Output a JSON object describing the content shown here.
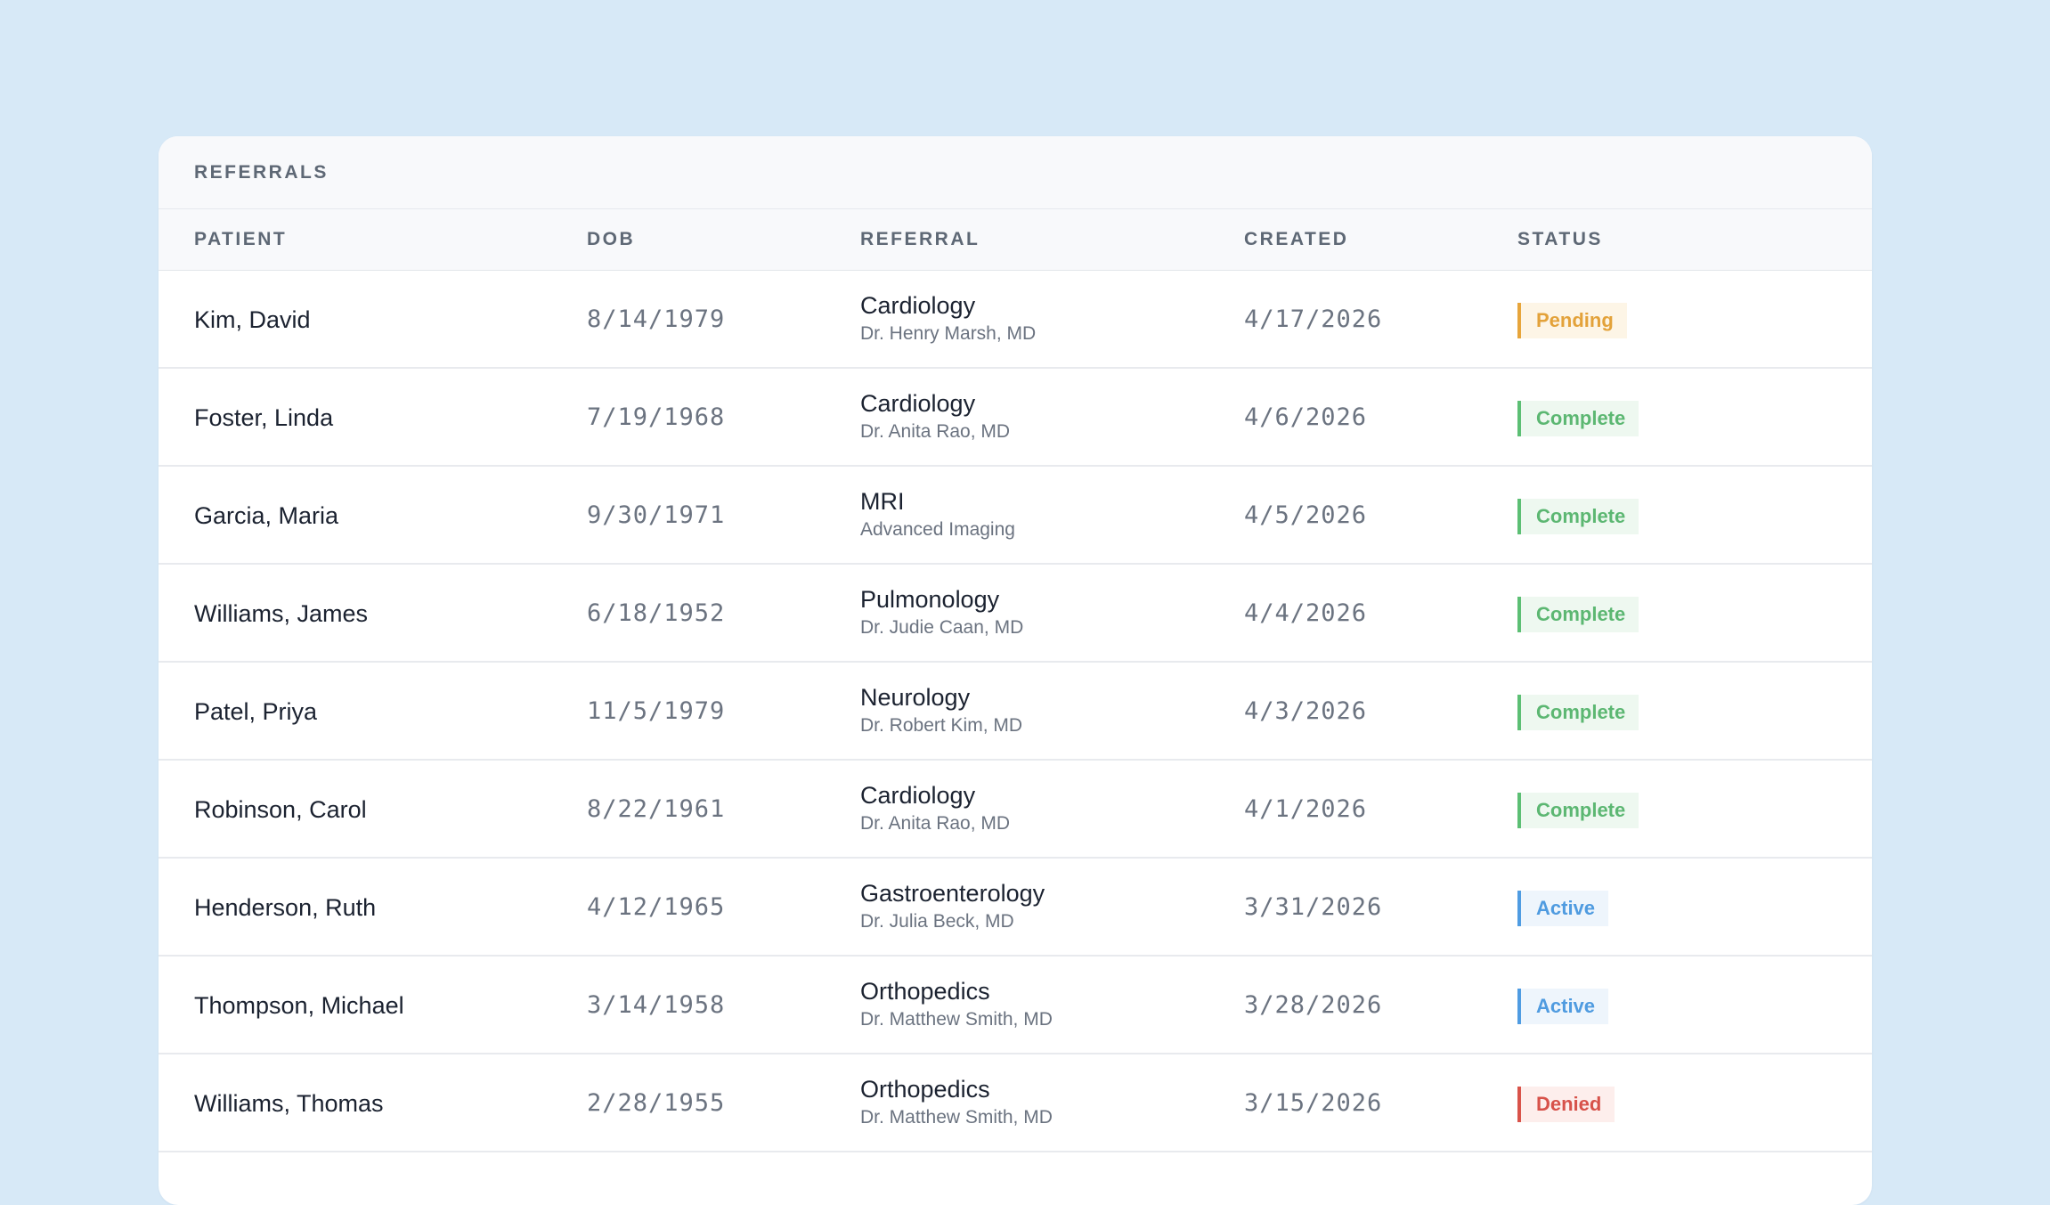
{
  "card": {
    "title": "REFERRALS"
  },
  "columns": {
    "patient": "PATIENT",
    "dob": "DOB",
    "referral": "REFERRAL",
    "created": "CREATED",
    "status": "STATUS"
  },
  "status_colors": {
    "Pending": "#e7a53b",
    "Complete": "#5cbf74",
    "Active": "#4f9ce2",
    "Denied": "#d9534a"
  },
  "rows": [
    {
      "patient": "Kim, David",
      "dob": "8/14/1979",
      "referral_type": "Cardiology",
      "referral_sub": "Dr. Henry Marsh, MD",
      "created": "4/17/2026",
      "status": "Pending"
    },
    {
      "patient": "Foster, Linda",
      "dob": "7/19/1968",
      "referral_type": "Cardiology",
      "referral_sub": "Dr. Anita Rao, MD",
      "created": "4/6/2026",
      "status": "Complete"
    },
    {
      "patient": "Garcia, Maria",
      "dob": "9/30/1971",
      "referral_type": "MRI",
      "referral_sub": "Advanced Imaging",
      "created": "4/5/2026",
      "status": "Complete"
    },
    {
      "patient": "Williams, James",
      "dob": "6/18/1952",
      "referral_type": "Pulmonology",
      "referral_sub": "Dr. Judie Caan, MD",
      "created": "4/4/2026",
      "status": "Complete"
    },
    {
      "patient": "Patel, Priya",
      "dob": "11/5/1979",
      "referral_type": "Neurology",
      "referral_sub": "Dr. Robert Kim, MD",
      "created": "4/3/2026",
      "status": "Complete"
    },
    {
      "patient": "Robinson, Carol",
      "dob": "8/22/1961",
      "referral_type": "Cardiology",
      "referral_sub": "Dr. Anita Rao, MD",
      "created": "4/1/2026",
      "status": "Complete"
    },
    {
      "patient": "Henderson, Ruth",
      "dob": "4/12/1965",
      "referral_type": "Gastroenterology",
      "referral_sub": "Dr. Julia Beck, MD",
      "created": "3/31/2026",
      "status": "Active"
    },
    {
      "patient": "Thompson, Michael",
      "dob": "3/14/1958",
      "referral_type": "Orthopedics",
      "referral_sub": "Dr. Matthew Smith, MD",
      "created": "3/28/2026",
      "status": "Active"
    },
    {
      "patient": "Williams, Thomas",
      "dob": "2/28/1955",
      "referral_type": "Orthopedics",
      "referral_sub": "Dr. Matthew Smith, MD",
      "created": "3/15/2026",
      "status": "Denied"
    }
  ]
}
